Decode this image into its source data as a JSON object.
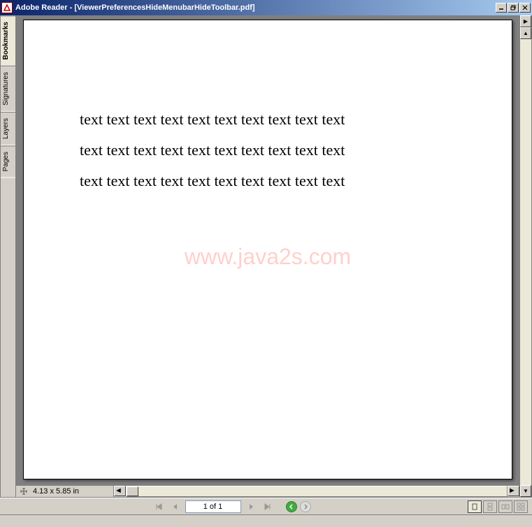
{
  "titlebar": {
    "app": "Adobe Reader",
    "doc": "[ViewerPreferencesHideMenubarHideToolbar.pdf]"
  },
  "sidetabs": {
    "bookmarks": "Bookmarks",
    "signatures": "Signatures",
    "layers": "Layers",
    "pages": "Pages"
  },
  "document": {
    "lines": [
      "text text text text text text text text text text",
      "text text text text text text text text text text",
      "text text text text text text text text text text"
    ],
    "watermark": "www.java2s.com"
  },
  "status": {
    "dimensions": "4.13 x 5.85 in",
    "page_display": "1 of 1"
  }
}
